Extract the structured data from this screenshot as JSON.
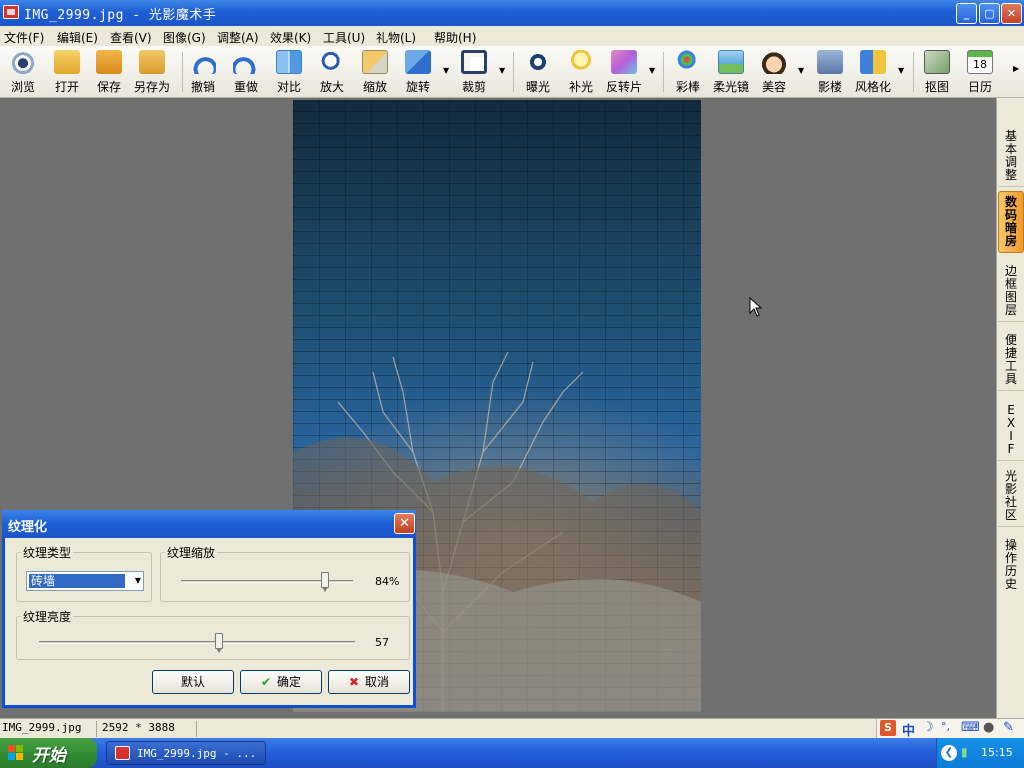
{
  "window": {
    "title": "IMG_2999.jpg - 光影魔术手",
    "minimize": "_",
    "maximize": "▢",
    "close": "✕"
  },
  "menu": [
    "文件(F)",
    "编辑(E)",
    "查看(V)",
    "图像(G)",
    "调整(A)",
    "效果(K)",
    "工具(U)",
    "礼物(L)",
    "帮助(H)"
  ],
  "toolbar": {
    "browse": "浏览",
    "open": "打开",
    "save": "保存",
    "save_as": "另存为",
    "undo": "撤销",
    "redo": "重做",
    "compare": "对比",
    "zoom_in": "放大",
    "scale": "缩放",
    "rotate": "旋转",
    "crop": "裁剪",
    "exposure": "曝光",
    "fill_light": "补光",
    "negative": "反转片",
    "color_stick": "彩棒",
    "soft_focus": "柔光镜",
    "beauty": "美容",
    "studio": "影楼",
    "stylize": "风格化",
    "cutout": "抠图",
    "calendar": "日历",
    "calendar_day": "18"
  },
  "right_panel": {
    "tabs": [
      "基本调整",
      "数码暗房",
      "边框图层",
      "便捷工具",
      "EXIF",
      "光影社区",
      "操作历史"
    ],
    "active_index": 1
  },
  "dialog": {
    "title": "纹理化",
    "type_label": "纹理类型",
    "type_value": "砖墙",
    "scale_label": "纹理缩放",
    "scale_value": "84%",
    "scale_fraction": 0.84,
    "brightness_label": "纹理亮度",
    "brightness_value": "57",
    "brightness_fraction": 0.57,
    "default_button": "默认",
    "ok_button": "确定",
    "cancel_button": "取消"
  },
  "statusbar": {
    "filename": "IMG_2999.jpg",
    "dimensions": "2592 * 3888"
  },
  "ime": {
    "lang": "中"
  },
  "taskbar": {
    "start": "开始",
    "task": "IMG_2999.jpg - ...",
    "clock": "15:15"
  },
  "colors": {
    "titlebar": "#1f5fd6",
    "taskbar": "#245edb",
    "start": "#318a31",
    "active_tab": "#f09a2c"
  }
}
